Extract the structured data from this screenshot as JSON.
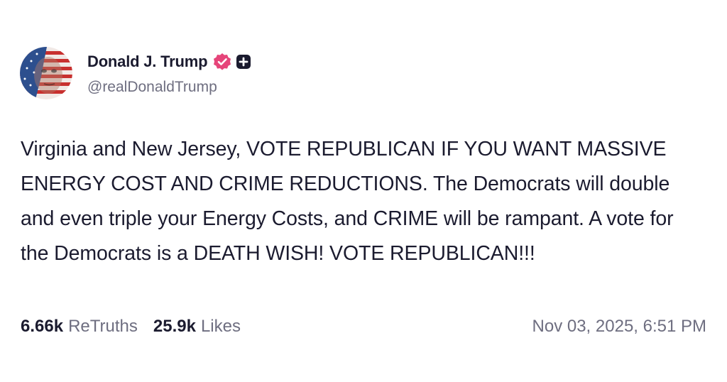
{
  "post": {
    "author": {
      "display_name": "Donald J. Trump",
      "handle": "@realDonaldTrump",
      "verified_icon": "verified-badge-icon",
      "verified_color": "#e6457a",
      "plus_icon": "plus-badge-icon"
    },
    "text": "Virginia and New Jersey, VOTE REPUBLICAN IF YOU WANT MASSIVE ENERGY COST AND CRIME REDUCTIONS. The Democrats will double and even triple your Energy Costs, and CRIME will be rampant. A vote for the Democrats is a DEATH WISH! VOTE REPUBLICAN!!!",
    "stats": {
      "retruths_count": "6.66k",
      "retruths_label": "ReTruths",
      "likes_count": "25.9k",
      "likes_label": "Likes"
    },
    "timestamp": "Nov 03, 2025, 6:51 PM"
  }
}
